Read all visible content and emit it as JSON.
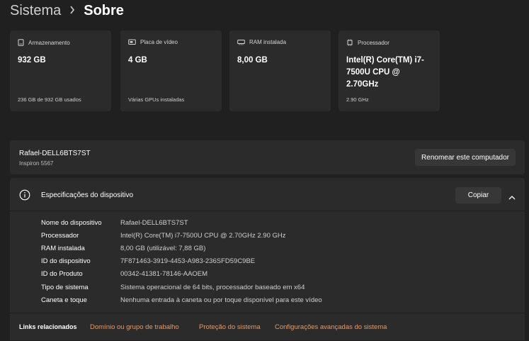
{
  "breadcrumb": {
    "parent": "Sistema",
    "current": "Sobre"
  },
  "cards": [
    {
      "icon": "storage-icon",
      "label": "Armazenamento",
      "value": "932 GB",
      "sub": "236 GB de 932 GB usados"
    },
    {
      "icon": "gpu-icon",
      "label": "Placa de vídeo",
      "value": "4 GB",
      "sub": "Várias GPUs instaladas"
    },
    {
      "icon": "ram-icon",
      "label": "RAM instalada",
      "value": "8,00 GB",
      "sub": ""
    },
    {
      "icon": "processor-icon",
      "label": "Processador",
      "value": "Intel(R) Core(TM) i7-7500U CPU @ 2.70GHz",
      "sub": "2.90 GHz"
    }
  ],
  "device": {
    "name": "Rafael-DELL6BTS7ST",
    "model": "Inspiron 5567",
    "rename_label": "Renomear este computador"
  },
  "specs": {
    "title": "Especificações do dispositivo",
    "copy_label": "Copiar",
    "rows": [
      {
        "label": "Nome do dispositivo",
        "value": "Rafael-DELL6BTS7ST"
      },
      {
        "label": "Processador",
        "value": "Intel(R) Core(TM) i7-7500U CPU @ 2.70GHz   2.90 GHz"
      },
      {
        "label": "RAM instalada",
        "value": "8,00 GB (utilizável: 7,88 GB)"
      },
      {
        "label": "ID do dispositivo",
        "value": "7F871463-3919-4453-A983-236SFD59C9BE"
      },
      {
        "label": "ID do Produto",
        "value": "00342-41381-78146-AAOEM"
      },
      {
        "label": "Tipo de sistema",
        "value": "Sistema operacional de 64 bits, processador baseado em x64"
      },
      {
        "label": "Caneta e toque",
        "value": "Nenhuma entrada à caneta ou por toque disponível para este vídeo"
      }
    ]
  },
  "related": {
    "label": "Links relacionados",
    "links": [
      "Domínio ou grupo de trabalho",
      "Proteção do sistema",
      "Configurações avançadas do sistema"
    ]
  },
  "colors": {
    "background": "#202020",
    "card": "#2b2b2b",
    "link": "#e59a6b"
  }
}
